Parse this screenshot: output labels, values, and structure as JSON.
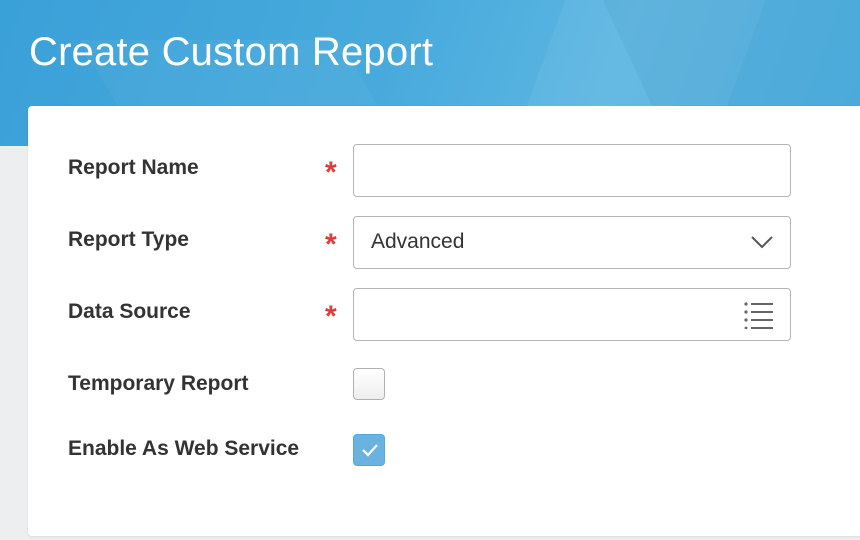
{
  "header": {
    "title": "Create Custom Report"
  },
  "form": {
    "report_name": {
      "label": "Report Name",
      "required_mark": "*",
      "value": ""
    },
    "report_type": {
      "label": "Report Type",
      "required_mark": "*",
      "value": "Advanced"
    },
    "data_source": {
      "label": "Data Source",
      "required_mark": "*",
      "value": ""
    },
    "temporary_report": {
      "label": "Temporary Report",
      "checked": false
    },
    "enable_web_service": {
      "label": "Enable As Web Service",
      "checked": true
    }
  },
  "icons": {
    "dropdown": "chevron-down-icon",
    "prompt": "list-icon",
    "checkmark": "checkmark-icon"
  },
  "colors": {
    "header": "#48aadc",
    "required": "#e03a3a",
    "checkbox_checked": "#6ab3e0"
  }
}
